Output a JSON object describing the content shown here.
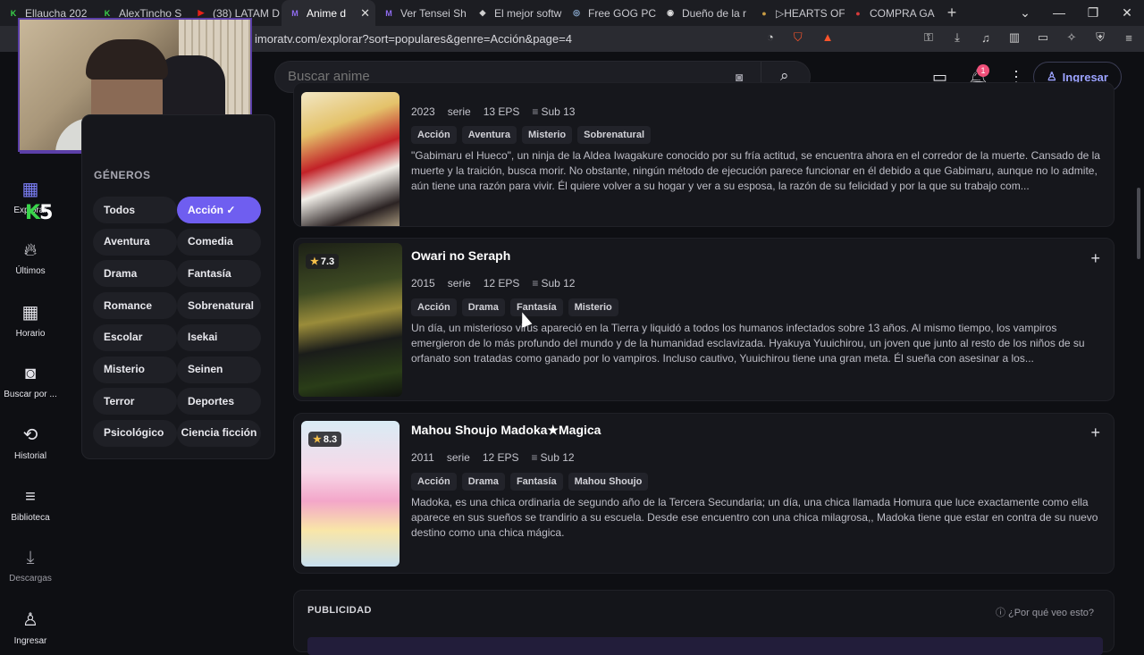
{
  "browser": {
    "tabs": [
      {
        "label": "Ellaucha 202",
        "fav": "K",
        "favcolor": "#3ad44b"
      },
      {
        "label": "AlexTincho S",
        "fav": "K",
        "favcolor": "#3ad44b"
      },
      {
        "label": "(38) LATAM D",
        "fav": "▶",
        "favcolor": "#e62117"
      },
      {
        "label": "Anime d",
        "fav": "M",
        "favcolor": "#8f6cf0"
      },
      {
        "label": "Ver Tensei Sh",
        "fav": "M",
        "favcolor": "#8f6cf0"
      },
      {
        "label": "El mejor softw",
        "fav": "◆",
        "favcolor": "#cfcfcf"
      },
      {
        "label": "Free GOG PC",
        "fav": "◎",
        "favcolor": "#8fb0d8"
      },
      {
        "label": "Dueño de la r",
        "fav": "◉",
        "favcolor": "#e0e0e0"
      },
      {
        "label": "▷HEARTS OF",
        "fav": "●",
        "favcolor": "#c79b44"
      },
      {
        "label": "COMPRA GA",
        "fav": "●",
        "favcolor": "#d63a3a"
      }
    ],
    "url": "imoratv.com/explorar?sort=populares&genre=Acción&page=4",
    "brave_badge": "1"
  },
  "header": {
    "search_placeholder": "Buscar anime",
    "notif_count": "1",
    "login_label": "Ingresar"
  },
  "rail": [
    {
      "label": "Explorar",
      "icon": "grid-icon"
    },
    {
      "label": "Últimos",
      "icon": "fire-icon"
    },
    {
      "label": "Horario",
      "icon": "calendar-icon"
    },
    {
      "label": "Buscar por ...",
      "icon": "camera-icon"
    },
    {
      "label": "Historial",
      "icon": "history-icon"
    },
    {
      "label": "Biblioteca",
      "icon": "library-icon"
    },
    {
      "label": "Descargas",
      "icon": "download-icon"
    },
    {
      "label": "Ingresar",
      "icon": "user-icon"
    }
  ],
  "overlay": {
    "k5_k": "K",
    "k5_n": "5"
  },
  "genres": {
    "title": "GÉNEROS",
    "items": [
      "Todos",
      "Acción ✓",
      "Aventura",
      "Comedia",
      "Drama",
      "Fantasía",
      "Romance",
      "Sobrenatural",
      "Escolar",
      "Isekai",
      "Misterio",
      "Seinen",
      "Terror",
      "Deportes",
      "Psicológico",
      "Ciencia ficción"
    ],
    "active": "Acción"
  },
  "cards": [
    {
      "title": "",
      "year": "2023",
      "type": "serie",
      "eps": "13 EPS",
      "sub": "Sub 13",
      "tags": [
        "Acción",
        "Aventura",
        "Misterio",
        "Sobrenatural"
      ],
      "desc": "\"Gabimaru el Hueco\", un ninja de la Aldea Iwagakure conocido por su fría actitud, se encuentra ahora en el corredor de la muerte. Cansado de la muerte y la traición, busca morir. No obstante, ningún método de ejecución parece funcionar en él debido a que Gabimaru, aunque no lo admite, aún tiene una razón para vivir. Él quiere volver a su hogar y ver a su esposa, la razón de su felicidad y por la que su trabajo com..."
    },
    {
      "title": "Owari no Seraph",
      "rating": "7.3",
      "year": "2015",
      "type": "serie",
      "eps": "12 EPS",
      "sub": "Sub 12",
      "tags": [
        "Acción",
        "Drama",
        "Fantasía",
        "Misterio"
      ],
      "desc": "Un día, un misterioso virus apareció en la Tierra y liquidó a todos los humanos infectados sobre 13 años. Al mismo tiempo, los vampiros emergieron de lo más profundo del mundo y de la humanidad esclavizada. Hyakuya Yuuichirou, un joven que junto al resto de los niños de su orfanato son tratadas como ganado por lo vampiros. Incluso cautivo, Yuuichirou tiene una gran meta. Él sueña con asesinar a los..."
    },
    {
      "title": "Mahou Shoujo Madoka★Magica",
      "rating": "8.3",
      "year": "2011",
      "type": "serie",
      "eps": "12 EPS",
      "sub": "Sub 12",
      "tags": [
        "Acción",
        "Drama",
        "Fantasía",
        "Mahou Shoujo"
      ],
      "desc": "Madoka, es una chica ordinaria de segundo año de la Tercera Secundaria; un día, una chica llamada Homura que luce exactamente como ella aparece en sus sueños se trandirio a su escuela. Desde ese encuentro con una chica milagrosa,, Madoka tiene que estar en contra de su nuevo destino como una chica mágica."
    }
  ],
  "ad": {
    "title": "PUBLICIDAD",
    "why": "ⓘ ¿Por qué veo esto?"
  }
}
